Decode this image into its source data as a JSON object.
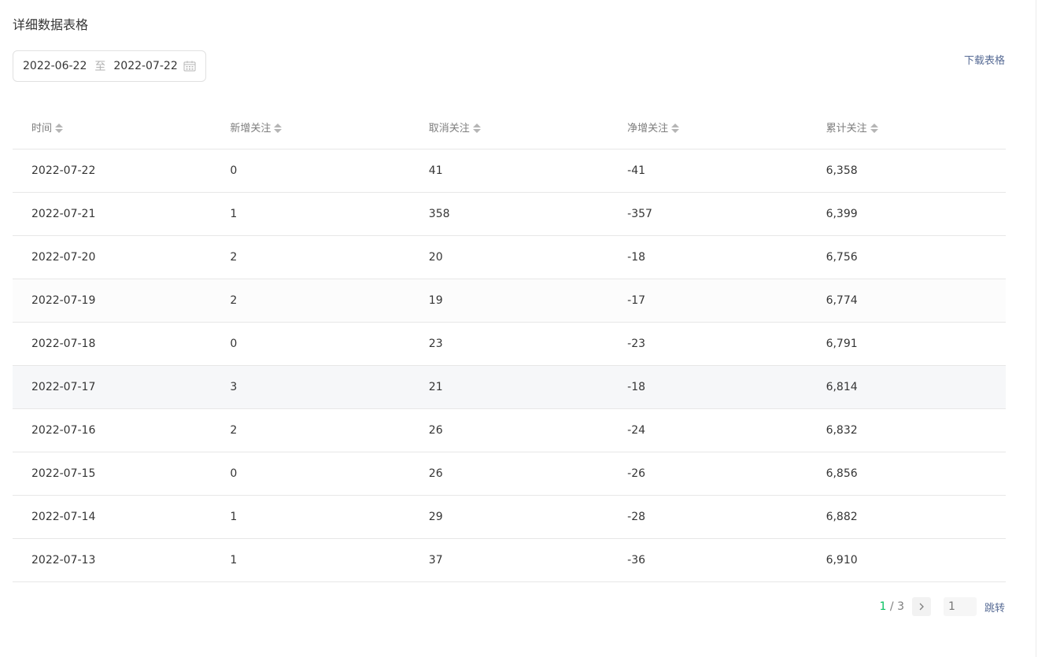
{
  "section_title": "详细数据表格",
  "date_range": {
    "start": "2022-06-22",
    "separator": "至",
    "end": "2022-07-22",
    "icon": "calendar-icon"
  },
  "download_label": "下载表格",
  "table": {
    "headers": [
      "时间",
      "新增关注",
      "取消关注",
      "净增关注",
      "累计关注"
    ],
    "rows": [
      [
        "2022-07-22",
        "0",
        "41",
        "-41",
        "6,358"
      ],
      [
        "2022-07-21",
        "1",
        "358",
        "-357",
        "6,399"
      ],
      [
        "2022-07-20",
        "2",
        "20",
        "-18",
        "6,756"
      ],
      [
        "2022-07-19",
        "2",
        "19",
        "-17",
        "6,774"
      ],
      [
        "2022-07-18",
        "0",
        "23",
        "-23",
        "6,791"
      ],
      [
        "2022-07-17",
        "3",
        "21",
        "-18",
        "6,814"
      ],
      [
        "2022-07-16",
        "2",
        "26",
        "-24",
        "6,832"
      ],
      [
        "2022-07-15",
        "0",
        "26",
        "-26",
        "6,856"
      ],
      [
        "2022-07-14",
        "1",
        "29",
        "-28",
        "6,882"
      ],
      [
        "2022-07-13",
        "1",
        "37",
        "-36",
        "6,910"
      ]
    ]
  },
  "pagination": {
    "current": "1",
    "separator": " / ",
    "total": "3",
    "input_placeholder": "1",
    "jump_label": "跳转"
  },
  "colors": {
    "accent": "#07c160",
    "link": "#576b95"
  }
}
